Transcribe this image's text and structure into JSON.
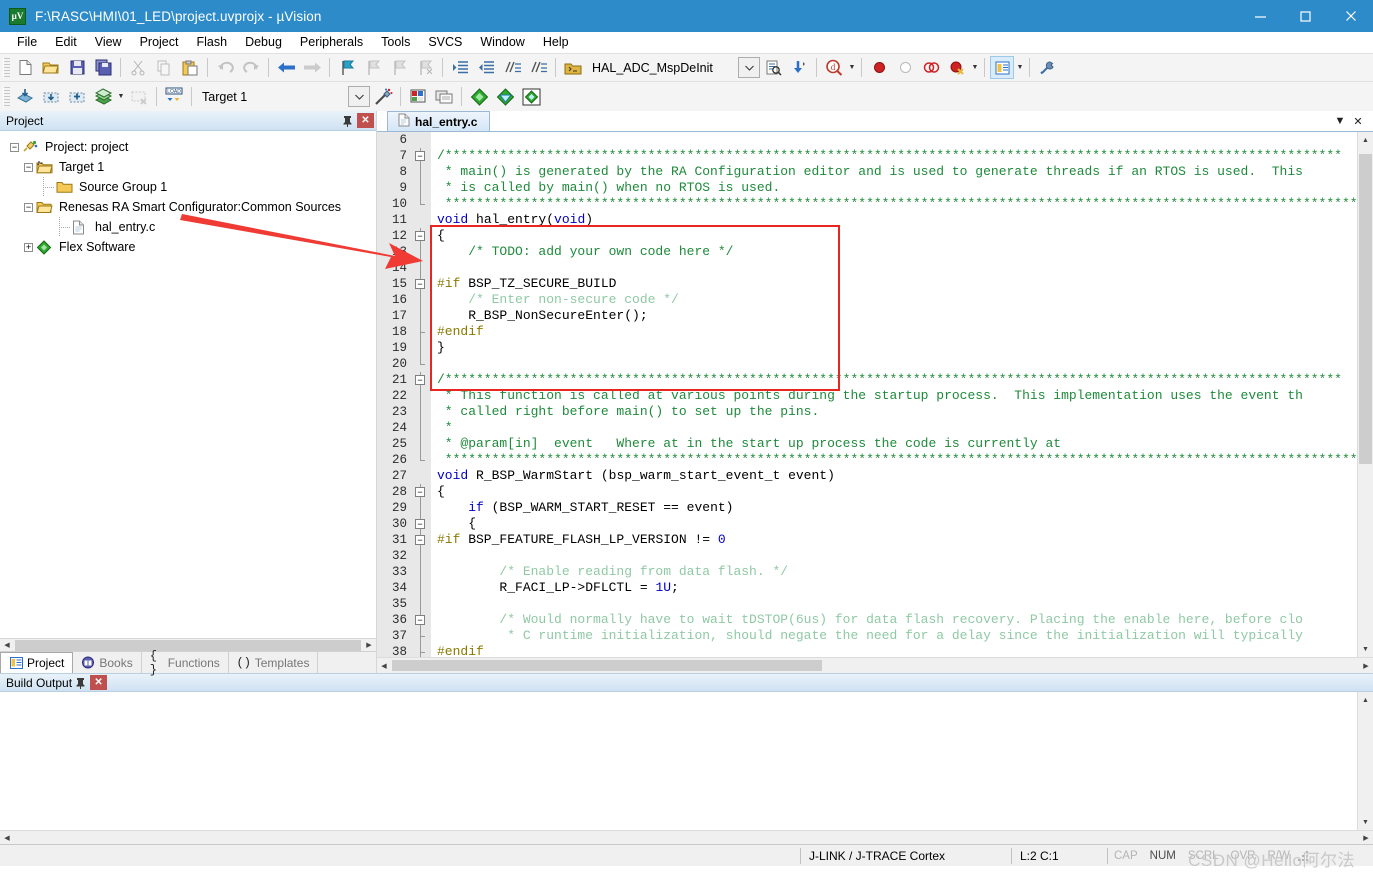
{
  "window": {
    "title": "F:\\RASC\\HMI\\01_LED\\project.uvprojx - µVision",
    "app_icon": "uvision-logo-icon",
    "minimize": "–",
    "maximize": "□",
    "close": "✕"
  },
  "menu": {
    "items": [
      "File",
      "Edit",
      "View",
      "Project",
      "Flash",
      "Debug",
      "Peripherals",
      "Tools",
      "SVCS",
      "Window",
      "Help"
    ]
  },
  "toolbar1": {
    "buttons": [
      {
        "name": "new-file-icon",
        "enabled": true
      },
      {
        "name": "open-file-icon",
        "enabled": true
      },
      {
        "name": "save-icon",
        "enabled": true
      },
      {
        "name": "save-all-icon",
        "enabled": true
      },
      {
        "name": "cut-icon",
        "enabled": false
      },
      {
        "name": "copy-icon",
        "enabled": false
      },
      {
        "name": "paste-icon",
        "enabled": true
      },
      {
        "name": "undo-icon",
        "enabled": false
      },
      {
        "name": "redo-icon",
        "enabled": false
      },
      {
        "name": "navigate-back-icon",
        "enabled": true
      },
      {
        "name": "navigate-forward-icon",
        "enabled": false
      },
      {
        "name": "bookmark-toggle-icon",
        "enabled": true
      },
      {
        "name": "bookmark-prev-icon",
        "enabled": false
      },
      {
        "name": "bookmark-next-icon",
        "enabled": false
      },
      {
        "name": "bookmark-clear-icon",
        "enabled": false
      },
      {
        "name": "indent-icon",
        "enabled": true
      },
      {
        "name": "outdent-icon",
        "enabled": true
      },
      {
        "name": "comment-icon",
        "enabled": true
      },
      {
        "name": "uncomment-icon",
        "enabled": true
      }
    ],
    "function_combo_value": "HAL_ADC_MspDeInit",
    "buttons_right": [
      {
        "name": "find-in-files-icon",
        "enabled": true
      },
      {
        "name": "incremental-find-icon",
        "enabled": true
      },
      {
        "name": "find-icon",
        "enabled": true
      },
      {
        "name": "insert-breakpoint-icon",
        "enabled": true
      },
      {
        "name": "disable-breakpoint-icon",
        "enabled": true
      },
      {
        "name": "disable-all-breakpoints-icon",
        "enabled": true
      },
      {
        "name": "kill-all-breakpoints-icon",
        "enabled": true
      },
      {
        "name": "manage-windows-icon",
        "enabled": true,
        "selected": true
      },
      {
        "name": "configure-icon",
        "enabled": true
      }
    ]
  },
  "toolbar2": {
    "buttons": [
      {
        "name": "translate-icon",
        "enabled": true
      },
      {
        "name": "build-icon",
        "enabled": true
      },
      {
        "name": "rebuild-icon",
        "enabled": true
      },
      {
        "name": "batch-build-icon",
        "enabled": true
      },
      {
        "name": "stop-build-icon",
        "enabled": false
      },
      {
        "name": "download-icon",
        "enabled": true
      }
    ],
    "target_combo_value": "Target 1",
    "buttons_right": [
      {
        "name": "target-options-wizard-icon",
        "enabled": true
      },
      {
        "name": "target-options-icon",
        "enabled": true
      },
      {
        "name": "manage-project-items-icon",
        "enabled": true
      },
      {
        "name": "manage-runtime-env-icon",
        "enabled": true
      },
      {
        "name": "pack-installer-icon",
        "enabled": true
      },
      {
        "name": "multi-project-icon",
        "enabled": true
      }
    ]
  },
  "project_panel": {
    "title": "Project",
    "pin_icon": "pin-icon",
    "close_icon": "close-icon",
    "tree": [
      {
        "label": "Project: project",
        "level": 0,
        "expander": "-",
        "icon": "project-icon"
      },
      {
        "label": "Target 1",
        "level": 1,
        "expander": "-",
        "icon": "target-icon"
      },
      {
        "label": "Source Group 1",
        "level": 2,
        "expander": "",
        "icon": "folder-closed-icon"
      },
      {
        "label": "Renesas RA Smart Configurator:Common Sources",
        "level": 2,
        "expander": "-",
        "icon": "folder-open-icon"
      },
      {
        "label": "hal_entry.c",
        "level": 3,
        "expander": "",
        "icon": "c-file-icon"
      },
      {
        "label": "Flex Software",
        "level": 2,
        "expander": "+",
        "icon": "component-icon"
      }
    ],
    "tabs": [
      {
        "label": "Project",
        "icon": "project-tab-icon",
        "selected": true
      },
      {
        "label": "Books",
        "icon": "books-tab-icon",
        "selected": false
      },
      {
        "label": "Functions",
        "icon": "functions-tab-icon",
        "selected": false
      },
      {
        "label": "Templates",
        "icon": "templates-tab-icon",
        "selected": false
      }
    ]
  },
  "editor": {
    "tab": {
      "label": "hal_entry.c",
      "icon": "c-file-icon"
    },
    "header_menu_icon": "chevron-down-icon",
    "header_close_icon": "close-icon",
    "lines": [
      {
        "n": "6",
        "fold": "",
        "segs": []
      },
      {
        "n": "7",
        "fold": "minus",
        "segs": [
          {
            "t": "/*******************************************************************************************************************",
            "c": "c-cmt"
          }
        ]
      },
      {
        "n": "8",
        "fold": "bar",
        "segs": [
          {
            "t": " * main() is generated by the RA Configuration editor and is used to generate threads if an RTOS is used.  This",
            "c": "c-cmt"
          }
        ]
      },
      {
        "n": "9",
        "fold": "bar",
        "segs": [
          {
            "t": " * is called by main() when no RTOS is used.",
            "c": "c-cmt"
          }
        ]
      },
      {
        "n": "10",
        "fold": "end",
        "segs": [
          {
            "t": " **********************************************************************************************************************",
            "c": "c-cmt"
          }
        ]
      },
      {
        "n": "11",
        "fold": "",
        "segs": [
          {
            "t": "void",
            "c": "c-kw"
          },
          {
            "t": " hal_entry(",
            "c": "c-id"
          },
          {
            "t": "void",
            "c": "c-kw"
          },
          {
            "t": ")",
            "c": "c-id"
          }
        ]
      },
      {
        "n": "12",
        "fold": "minus",
        "segs": [
          {
            "t": "{",
            "c": "c-id"
          }
        ]
      },
      {
        "n": "13",
        "fold": "bar",
        "segs": [
          {
            "t": "    /* TODO: add your own code here */",
            "c": "c-cmt"
          }
        ]
      },
      {
        "n": "14",
        "fold": "bar",
        "segs": []
      },
      {
        "n": "15",
        "fold": "minus2",
        "segs": [
          {
            "t": "#if",
            "c": "c-pp"
          },
          {
            "t": " BSP_TZ_SECURE_BUILD",
            "c": "c-id"
          }
        ]
      },
      {
        "n": "16",
        "fold": "bar2",
        "segs": [
          {
            "t": "    /* Enter non-secure code */",
            "c": "c-cmt-l"
          }
        ]
      },
      {
        "n": "17",
        "fold": "bar2",
        "segs": [
          {
            "t": "    R_BSP_NonSecureEnter();",
            "c": "c-id"
          }
        ]
      },
      {
        "n": "18",
        "fold": "tick",
        "segs": [
          {
            "t": "#endif",
            "c": "c-pp"
          }
        ]
      },
      {
        "n": "19",
        "fold": "bar",
        "segs": [
          {
            "t": "}",
            "c": "c-id"
          }
        ]
      },
      {
        "n": "20",
        "fold": "end",
        "segs": []
      },
      {
        "n": "21",
        "fold": "minus",
        "segs": [
          {
            "t": "/*******************************************************************************************************************",
            "c": "c-cmt"
          }
        ]
      },
      {
        "n": "22",
        "fold": "bar",
        "segs": [
          {
            "t": " * This function is called at various points during the startup process.  This implementation uses the event th",
            "c": "c-cmt"
          }
        ]
      },
      {
        "n": "23",
        "fold": "bar",
        "segs": [
          {
            "t": " * called right before main() to set up the pins.",
            "c": "c-cmt"
          }
        ]
      },
      {
        "n": "24",
        "fold": "bar",
        "segs": [
          {
            "t": " *",
            "c": "c-cmt"
          }
        ]
      },
      {
        "n": "25",
        "fold": "bar",
        "segs": [
          {
            "t": " * @param[in]  event   Where at in the start up process the code is currently at",
            "c": "c-cmt"
          }
        ]
      },
      {
        "n": "26",
        "fold": "end",
        "segs": [
          {
            "t": " **********************************************************************************************************************",
            "c": "c-cmt"
          }
        ]
      },
      {
        "n": "27",
        "fold": "",
        "segs": [
          {
            "t": "void",
            "c": "c-kw"
          },
          {
            "t": " R_BSP_WarmStart (bsp_warm_start_event_t event)",
            "c": "c-id"
          }
        ]
      },
      {
        "n": "28",
        "fold": "minus",
        "segs": [
          {
            "t": "{",
            "c": "c-id"
          }
        ]
      },
      {
        "n": "29",
        "fold": "bar",
        "segs": [
          {
            "t": "    ",
            "c": "c-id"
          },
          {
            "t": "if",
            "c": "c-kw"
          },
          {
            "t": " (BSP_WARM_START_RESET == event)",
            "c": "c-id"
          }
        ]
      },
      {
        "n": "30",
        "fold": "minus2",
        "segs": [
          {
            "t": "    {",
            "c": "c-id"
          }
        ]
      },
      {
        "n": "31",
        "fold": "minus3",
        "segs": [
          {
            "t": "#if",
            "c": "c-pp"
          },
          {
            "t": " BSP_FEATURE_FLASH_LP_VERSION != ",
            "c": "c-id"
          },
          {
            "t": "0",
            "c": "c-num"
          }
        ]
      },
      {
        "n": "32",
        "fold": "bar3",
        "segs": []
      },
      {
        "n": "33",
        "fold": "bar3",
        "segs": [
          {
            "t": "        /* Enable reading from data flash. */",
            "c": "c-cmt-l"
          }
        ]
      },
      {
        "n": "34",
        "fold": "bar3",
        "segs": [
          {
            "t": "        R_FACI_LP->DFLCTL = ",
            "c": "c-id"
          },
          {
            "t": "1U",
            "c": "c-num"
          },
          {
            "t": ";",
            "c": "c-id"
          }
        ]
      },
      {
        "n": "35",
        "fold": "bar3",
        "segs": []
      },
      {
        "n": "36",
        "fold": "minus4",
        "segs": [
          {
            "t": "        /* Would normally have to wait tDSTOP(6us) for data flash recovery. Placing the enable here, before clo",
            "c": "c-cmt-l"
          }
        ]
      },
      {
        "n": "37",
        "fold": "tick2",
        "segs": [
          {
            "t": "         * C runtime initialization, should negate the need for a delay since the initialization will typically",
            "c": "c-cmt-l"
          }
        ]
      },
      {
        "n": "38",
        "fold": "tick",
        "segs": [
          {
            "t": "#endif",
            "c": "c-pp"
          }
        ]
      }
    ]
  },
  "annotation": {
    "box_color": "#e8251f",
    "arrow_color": "#ef3b33"
  },
  "build_output": {
    "title": "Build Output",
    "pin_icon": "pin-icon",
    "close_icon": "close-icon",
    "content": ""
  },
  "statusbar": {
    "debugger": "J-LINK / J-TRACE Cortex",
    "position": "L:2 C:1",
    "indicators": [
      {
        "label": "CAP",
        "active": false
      },
      {
        "label": "NUM",
        "active": true
      },
      {
        "label": "SCRL",
        "active": false
      },
      {
        "label": "OVR",
        "active": false
      },
      {
        "label": "R/W",
        "active": false
      }
    ]
  },
  "watermark": "CSDN @Hello阿尔法"
}
